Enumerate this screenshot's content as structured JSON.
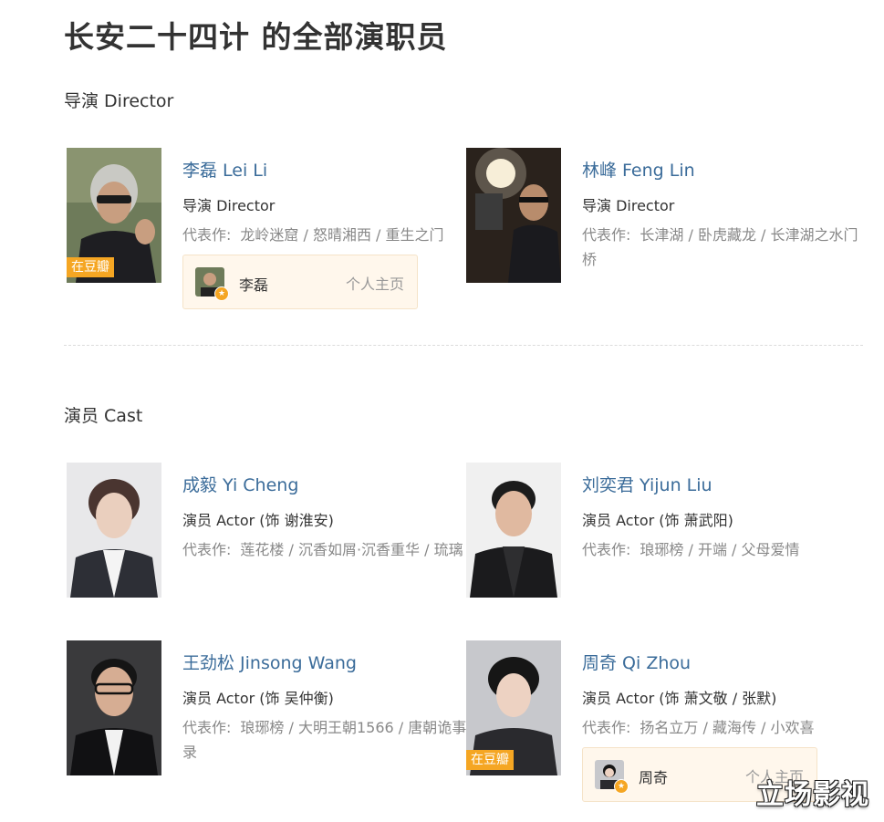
{
  "page": {
    "title": "长安二十四计 的全部演职员"
  },
  "sections": {
    "director": "导演 Director",
    "cast": "演员 Cast"
  },
  "labels": {
    "works_label": "代表作:",
    "badge": "在豆瓣",
    "homepage": "个人主页"
  },
  "directors": [
    {
      "name": "李磊 Lei Li",
      "role": "导演 Director",
      "works": "龙岭迷窟 / 怒晴湘西 / 重生之门",
      "has_badge": true,
      "profile_name": "李磊"
    },
    {
      "name": "林峰 Feng Lin",
      "role": "导演 Director",
      "works": "长津湖 / 卧虎藏龙 / 长津湖之水门桥",
      "has_badge": false
    }
  ],
  "cast": [
    {
      "name": "成毅 Yi Cheng",
      "role": "演员 Actor (饰 谢淮安)",
      "works": "莲花楼 / 沉香如屑·沉香重华 / 琉璃",
      "has_badge": false
    },
    {
      "name": "刘奕君 Yijun Liu",
      "role": "演员 Actor (饰 萧武阳)",
      "works": "琅琊榜 / 开端 / 父母爱情",
      "has_badge": false
    },
    {
      "name": "王劲松 Jinsong Wang",
      "role": "演员 Actor (饰 吴仲衡)",
      "works": "琅琊榜 / 大明王朝1566 / 唐朝诡事录",
      "has_badge": false
    },
    {
      "name": "周奇 Qi Zhou",
      "role": "演员 Actor (饰 萧文敬 / 张默)",
      "works": "扬名立万 / 藏海传 / 小欢喜",
      "has_badge": true,
      "profile_name": "周奇"
    }
  ],
  "watermark": "立场影视"
}
